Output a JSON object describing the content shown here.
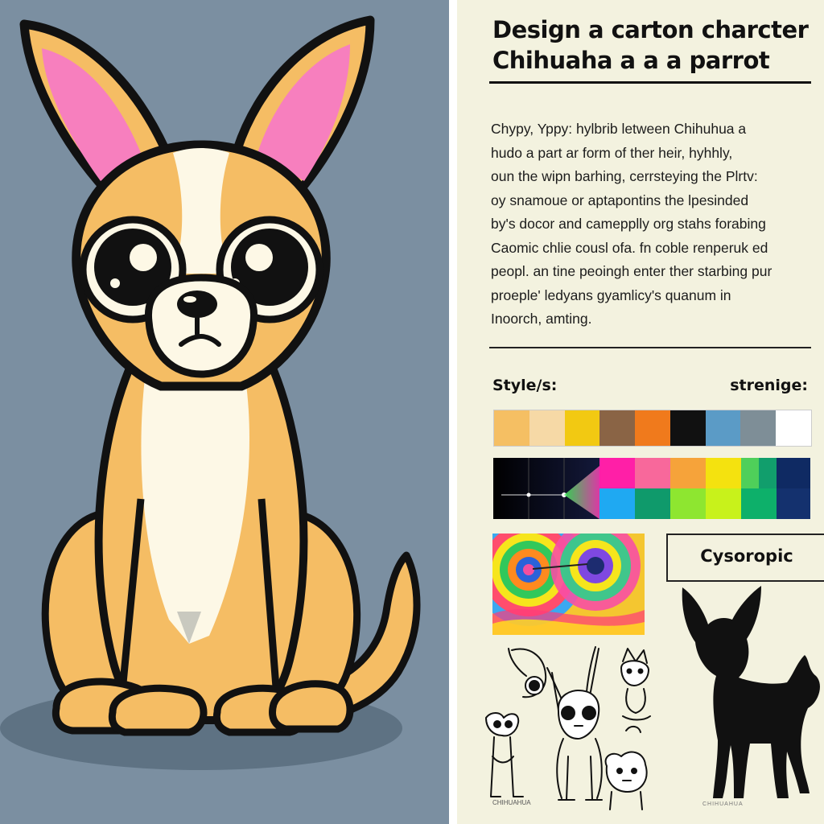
{
  "title": {
    "line1": "Design a carton charcter",
    "line2": "Chihuaha a a a parrot"
  },
  "body_lines": [
    "Chypy, Yppy: hylbrib letween Chihuhua a",
    "hudo  a part ar form of ther heir, hyhhly,",
    "oun the wipn barhing, cerrsteying the Plrtv:",
    "oy snamoue or aptapontins the lpesinded",
    "by's docor and camepplly org stahs forabing",
    "Caomic chlie cousl ofa.  fn  coble renperuk ed",
    "peopl. an tine peoingh enter ther starbing pur",
    "proeple' ledyans gyamlicy's quanum in",
    "Inoorch, amting."
  ],
  "labels": {
    "style": "Style/s:",
    "strenige": "strenige:",
    "cysoropic": "Cysoropic",
    "sketch_caption": "CHIHUAHUA",
    "silhouette_caption": "CHIHUAHUA"
  },
  "palette": [
    "#f5bf63",
    "#f6d9a6",
    "#f2c912",
    "#8a6445",
    "#f07a1c",
    "#111111",
    "#5b9bc6",
    "#7e8e97",
    "#ffffff"
  ],
  "colors": {
    "background_left": "#7b8fa1",
    "fur": "#f5bd64",
    "cream": "#fdf8e6",
    "ear_inner": "#f77fbe",
    "outline": "#111111",
    "panel_right": "#f3f2df"
  },
  "icons": [
    "chihuahua-character",
    "chihuahua-silhouette",
    "chihuahua-sketches",
    "tie-dye-swirl"
  ]
}
